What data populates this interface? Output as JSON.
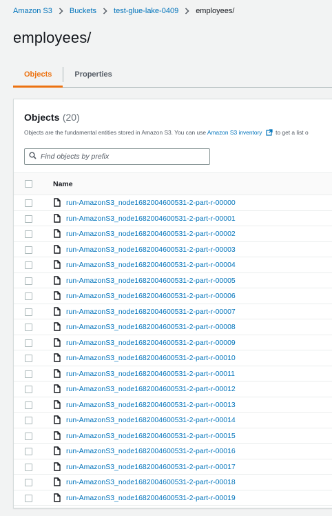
{
  "breadcrumb": {
    "items": [
      "Amazon S3",
      "Buckets",
      "test-glue-lake-0409"
    ],
    "current": "employees/"
  },
  "page": {
    "title": "employees/"
  },
  "tabs": [
    {
      "label": "Objects",
      "active": true
    },
    {
      "label": "Properties",
      "active": false
    }
  ],
  "objects_panel": {
    "title": "Objects",
    "count": "(20)",
    "description_prefix": "Objects are the fundamental entities stored in Amazon S3. You can use",
    "description_link": "Amazon S3 inventory",
    "description_suffix": "to get a list o",
    "search_placeholder": "Find objects by prefix",
    "column_name": "Name",
    "objects": [
      "run-AmazonS3_node1682004600531-2-part-r-00000",
      "run-AmazonS3_node1682004600531-2-part-r-00001",
      "run-AmazonS3_node1682004600531-2-part-r-00002",
      "run-AmazonS3_node1682004600531-2-part-r-00003",
      "run-AmazonS3_node1682004600531-2-part-r-00004",
      "run-AmazonS3_node1682004600531-2-part-r-00005",
      "run-AmazonS3_node1682004600531-2-part-r-00006",
      "run-AmazonS3_node1682004600531-2-part-r-00007",
      "run-AmazonS3_node1682004600531-2-part-r-00008",
      "run-AmazonS3_node1682004600531-2-part-r-00009",
      "run-AmazonS3_node1682004600531-2-part-r-00010",
      "run-AmazonS3_node1682004600531-2-part-r-00011",
      "run-AmazonS3_node1682004600531-2-part-r-00012",
      "run-AmazonS3_node1682004600531-2-part-r-00013",
      "run-AmazonS3_node1682004600531-2-part-r-00014",
      "run-AmazonS3_node1682004600531-2-part-r-00015",
      "run-AmazonS3_node1682004600531-2-part-r-00016",
      "run-AmazonS3_node1682004600531-2-part-r-00017",
      "run-AmazonS3_node1682004600531-2-part-r-00018",
      "run-AmazonS3_node1682004600531-2-part-r-00019"
    ]
  },
  "icons": {
    "breadcrumb_separator": "chevron-right-icon",
    "search": "search-icon",
    "external_link": "external-link-icon",
    "file": "file-icon"
  },
  "colors": {
    "link": "#0073bb",
    "active_tab": "#ec7211",
    "background": "#f2f3f3"
  }
}
